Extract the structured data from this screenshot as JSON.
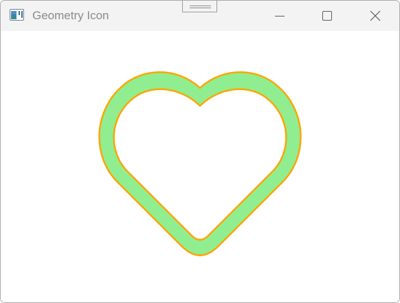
{
  "window": {
    "title": "Geometry Icon",
    "icons": {
      "app": "window-app-icon",
      "grip": "drag-grip-icon",
      "minimize": "minimize-icon",
      "maximize": "maximize-icon",
      "close": "close-icon"
    }
  },
  "heart": {
    "shape": "heart-outline",
    "fill_color": "#90EE90",
    "stroke_color": "#FFA500"
  }
}
